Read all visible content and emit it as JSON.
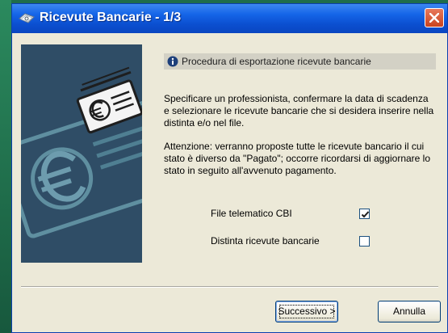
{
  "window": {
    "title": "Ricevute Bancarie - 1/3"
  },
  "info": {
    "header": "Procedura di esportazione ricevute bancarie",
    "paragraph1": "Specificare un professionista, confermare la data di scadenza e selezionare le ricevute bancarie che si desidera inserire nella distinta e/o nel file.",
    "paragraph2": "Attenzione: verranno proposte tutte le ricevute bancario il cui stato è diverso da \"Pagato\"; occorre ricordarsi di aggiornare lo stato in seguito all'avvenuto pagamento."
  },
  "options": [
    {
      "label": "File telematico CBI",
      "checked": true
    },
    {
      "label": "Distinta ricevute bancarie",
      "checked": false
    }
  ],
  "buttons": {
    "next": "Successivo >",
    "cancel": "Annulla"
  },
  "colors": {
    "titlebar": "#0b4fd0",
    "window_bg": "#ece9d8",
    "side_art": "#2f4d66"
  }
}
